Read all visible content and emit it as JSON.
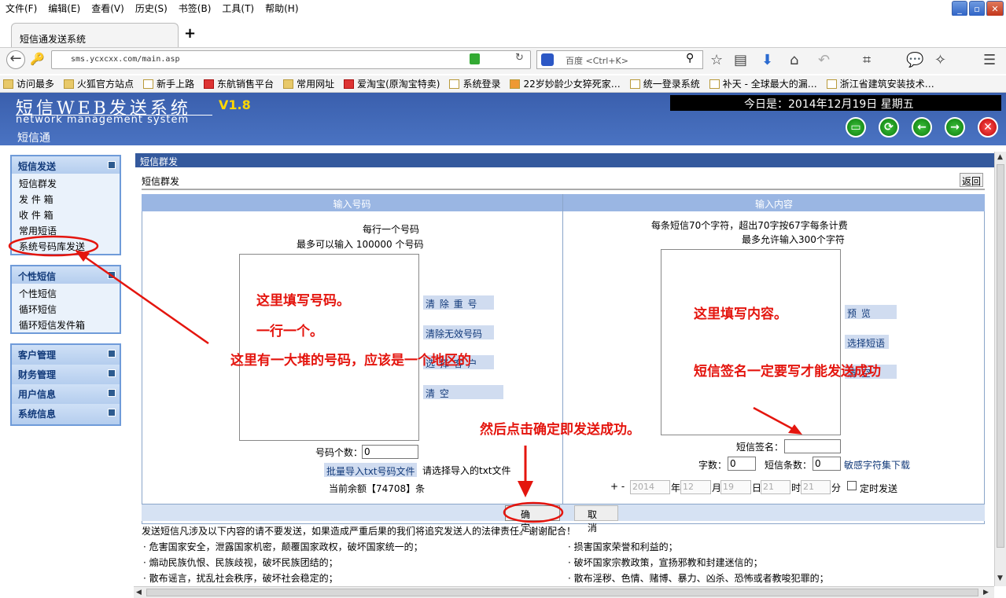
{
  "browser": {
    "menu": [
      "文件(F)",
      "编辑(E)",
      "查看(V)",
      "历史(S)",
      "书签(B)",
      "工具(T)",
      "帮助(H)"
    ],
    "tab_title": "短信通发送系统",
    "url_host": "sms.ycxcxx.com",
    "url_path": "/main.asp",
    "search_engine": "百度",
    "search_placeholder": "<Ctrl+K>",
    "bookmarks": [
      "访问最多",
      "火狐官方站点",
      "新手上路",
      "东航销售平台",
      "常用网址",
      "爱淘宝(原淘宝特卖)",
      "系统登录",
      "22岁妙龄少女猝死家…",
      "统一登录系统",
      "补天 - 全球最大的漏…",
      "浙江省建筑安装技术…"
    ]
  },
  "header": {
    "logo": "短信WEB发送系统",
    "version": "V1.8",
    "subtitle_en": "network management system",
    "subtitle_cn": "短信通",
    "date_line": "今日是：2014年12月19日  星期五"
  },
  "sidebar": {
    "groups": [
      {
        "title": "短信发送",
        "items": [
          "短信群发",
          "发 件 箱",
          "收 件 箱",
          "常用短语",
          "系统号码库发送"
        ]
      },
      {
        "title": "个性短信",
        "items": [
          "个性短信",
          "循环短信",
          "循环短信发件箱"
        ]
      },
      {
        "title": "客户管理",
        "items": []
      },
      {
        "title": "财务管理",
        "items": []
      },
      {
        "title": "用户信息",
        "items": []
      },
      {
        "title": "系统信息",
        "items": []
      }
    ]
  },
  "main": {
    "header": "短信群发",
    "subtitle": "短信群发",
    "back": "返回",
    "left_col": {
      "title": "输入号码",
      "hint1": "每行一个号码",
      "hint2": "最多可以输入 100000 个号码",
      "btn_dedup": "清 除 重 号",
      "btn_invalid": "清除无效号码",
      "btn_select": "选 择 客 户",
      "btn_clear": "清        空",
      "count_label": "号码个数：",
      "count_value": "0",
      "import_btn": "批量导入txt号码文件",
      "import_hint": "请选择导入的txt文件",
      "balance": "当前余额【74708】条"
    },
    "right_col": {
      "title": "输入内容",
      "hint1": "每条短信70个字符，超出70字按67字每条计费",
      "hint2": "最多允许输入300个字符",
      "btn_preview": "预    览",
      "btn_phrase": "选择短语",
      "btn_clear": "清    空",
      "sign_label": "短信签名：",
      "chars_label": "字数：",
      "chars_value": "0",
      "count_label": "短信条数：",
      "count_value": "0",
      "sensitive_link": "敏感字符集下载",
      "time_prefix": "+ -",
      "year": "2014",
      "year_label": "年",
      "month": "12",
      "month_label": "月",
      "day": "19",
      "day_label": "日",
      "hour": "21",
      "hour_label": "时",
      "minute": "21",
      "minute_label": "分",
      "schedule_label": "定时发送"
    },
    "confirm": "确 定",
    "cancel": "取 消",
    "notice": "发送短信凡涉及以下内容的请不要发送，如果造成严重后果的我们将追究发送人的法律责任。谢谢配合！",
    "rules_left": [
      "· 危害国家安全，泄露国家机密，颠覆国家政权，破坏国家统一的；",
      "· 煽动民族仇恨、民族歧视，破坏民族团结的；",
      "· 散布谣言，扰乱社会秩序，破坏社会稳定的；"
    ],
    "rules_right": [
      "· 损害国家荣誉和利益的；",
      "· 破坏国家宗教政策，宣扬邪教和封建迷信的；",
      "· 散布淫秽、色情、赌博、暴力、凶杀、恐怖或者教唆犯罪的；"
    ]
  },
  "annotations": {
    "fill_number": "这里填写号码。",
    "one_per_line": "一行一个。",
    "many_numbers": "这里有一大堆的号码，应该是一个地区的",
    "fill_content": "这里填写内容。",
    "signature": "短信签名一定要写才能发送成功",
    "then_click": "然后点击确定即发送成功。"
  },
  "colors": {
    "header_bg": "#3a5fad",
    "accent": "#34599d",
    "annotation": "#e4150e"
  }
}
